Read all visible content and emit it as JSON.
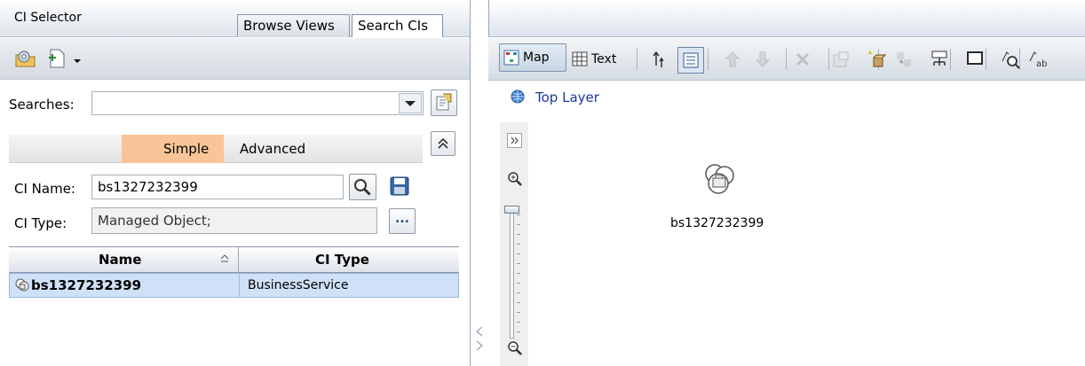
{
  "left_panel": {
    "title": "CI Selector",
    "tabs": [
      "Browse Views",
      "Search CIs"
    ],
    "searches_label": "Searches:",
    "searches_value": "",
    "mode_tabs": {
      "simple": "Simple",
      "advanced": "Advanced"
    },
    "ci_name_label": "CI Name:",
    "ci_name_value": "bs1327232399",
    "ci_type_label": "CI Type:",
    "ci_type_value": "Managed Object;",
    "ellipsis": "...",
    "grid": {
      "columns": [
        "Name",
        "CI Type"
      ],
      "rows": [
        {
          "name": "bs1327232399",
          "ci_type": "BusinessService"
        }
      ]
    }
  },
  "right_panel": {
    "toolbar": {
      "map": "Map",
      "text": "Text"
    },
    "breadcrumb": "Top Layer",
    "node_label": "bs1327232399"
  },
  "colors": {
    "accent_tab": "#f9c497",
    "selection": "#cfe1f7",
    "link": "#1d3a9a"
  }
}
